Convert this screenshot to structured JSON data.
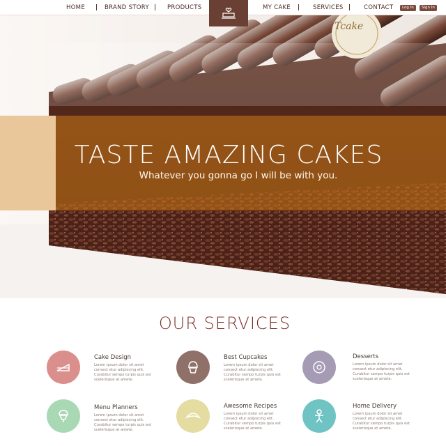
{
  "nav": {
    "items": [
      "HOME",
      "BRAND STORY",
      "PRODUCTS",
      "MY CAKE",
      "SERVICES",
      "CONTACT"
    ],
    "login_label": "Log In",
    "signin_label": "Sign In"
  },
  "hero": {
    "title": "TASTE AMAZING CAKES",
    "subtitle": "Whatever you gonna go I will be with you.",
    "badge_text": "Tcake"
  },
  "services": {
    "title": "OUR SERVICES",
    "items": [
      {
        "name": "Cake Design",
        "desc": "Lorem ipsum dolor sit amet\nconsect etur adipiscing elit.\nCurabitur sempo turpis quis est\nscelerisque at amete.",
        "icon": "cake-slice-icon",
        "color": "#db8f8c"
      },
      {
        "name": "Best Cupcakes",
        "desc": "Lorem ipsum dolor sit amet\nconsect etur adipiscing elit.\nCurabitur sempo turpis quis est\nscelerisque at amete.",
        "icon": "cupcake-icon",
        "color": "#8f716a"
      },
      {
        "name": "Desserts",
        "desc": "Lorem ipsum dolor sit amet\nconsect etur adipiscing elit.\nCurabitur sempo turpis quis est\nscelerisque at amete.",
        "icon": "donut-icon",
        "color": "#a69bb4"
      },
      {
        "name": "Menu Planners",
        "desc": "Lorem ipsum dolor sit amet\nconsect etur adipiscing elit.\nCurabitur sempo turpis quis est\nscelerisque at amete.",
        "icon": "ice-cream-icon",
        "color": "#a9d8b4"
      },
      {
        "name": "Awesome Recipes",
        "desc": "Lorem ipsum dolor sit amet\nconsect etur adipiscing elit.\nCurabitur sempo turpis quis est\nscelerisque at amete.",
        "icon": "croissant-icon",
        "color": "#e5dca2"
      },
      {
        "name": "Home Delivery",
        "desc": "Lorem ipsum dolor sit amet\nconsect etur adipiscing elit.\nCurabitur sempo turpis quis est\nscelerisque at amete.",
        "icon": "gingerbread-icon",
        "color": "#6fc3c3"
      }
    ]
  }
}
